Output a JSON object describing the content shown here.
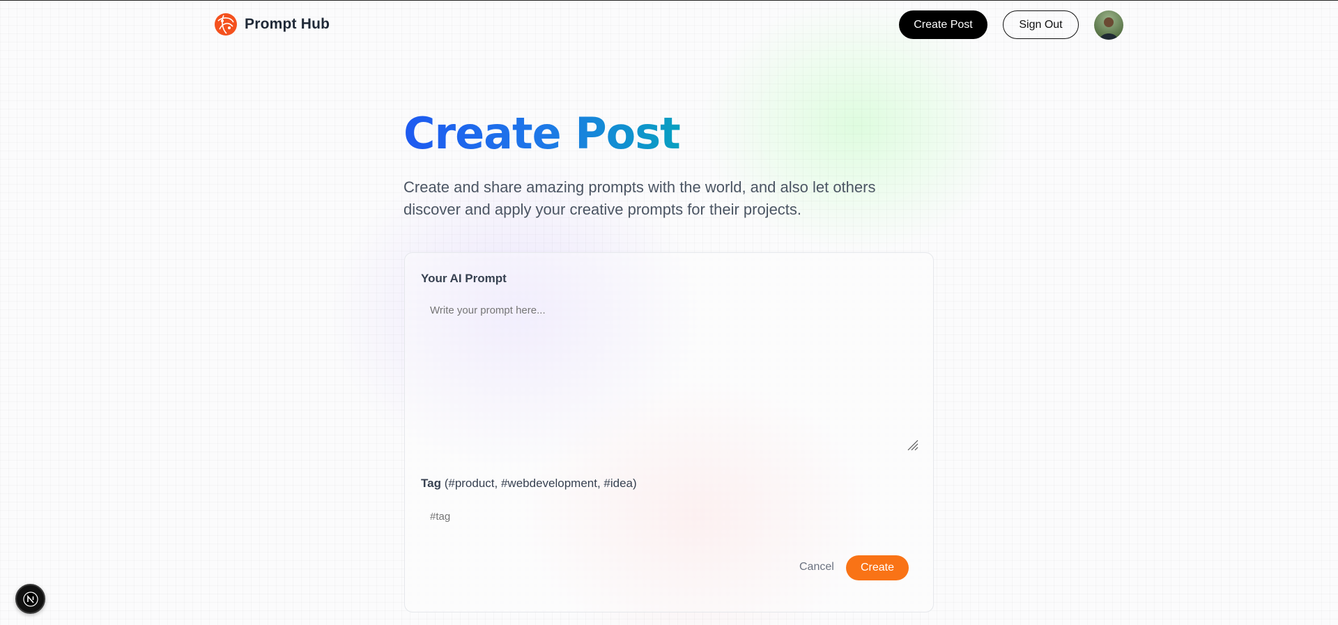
{
  "app": {
    "name": "Prompt Hub"
  },
  "nav": {
    "create_post_label": "Create Post",
    "sign_out_label": "Sign Out"
  },
  "hero": {
    "title": "Create Post",
    "subtitle": "Create and share amazing prompts with the world, and also let others discover and apply your creative prompts for their projects."
  },
  "form": {
    "prompt_label": "Your AI Prompt",
    "prompt_placeholder": "Write your prompt here...",
    "prompt_value": "",
    "tag_label_bold": "Tag",
    "tag_label_hint": "(#product, #webdevelopment, #idea)",
    "tag_placeholder": "#tag",
    "tag_value": "",
    "cancel_label": "Cancel",
    "create_label": "Create"
  },
  "colors": {
    "brand_orange": "#f97316",
    "title_gradient_start": "#1e5af0",
    "title_gradient_end": "#08a0c0"
  },
  "icons": {
    "logo": "prompt-hub-logo-icon",
    "dev": "nextjs-dev-indicator-icon"
  }
}
